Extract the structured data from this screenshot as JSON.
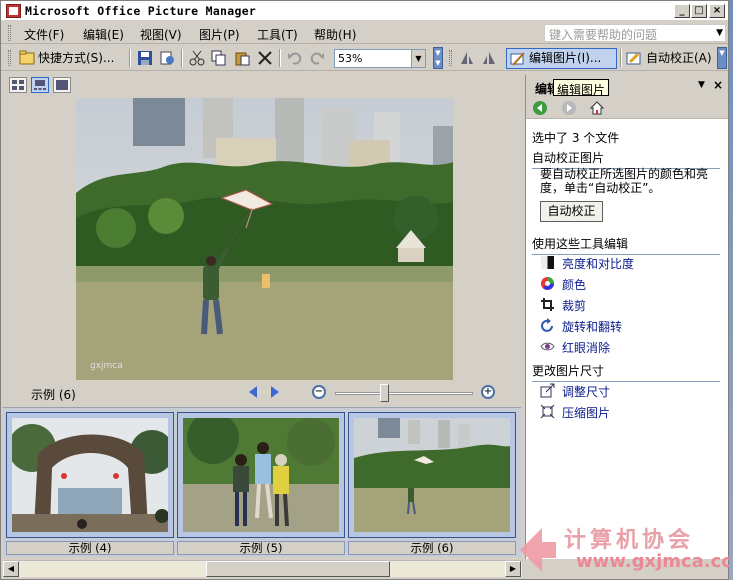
{
  "window": {
    "title": "Microsoft Office Picture Manager",
    "controls": [
      "_",
      "□",
      "×"
    ]
  },
  "menu": {
    "items": [
      "文件(F)",
      "编辑(E)",
      "视图(V)",
      "图片(P)",
      "工具(T)",
      "帮助(H)"
    ],
    "help_placeholder": "键入需要帮助的问题"
  },
  "toolbar": {
    "shortcuts_label": "快捷方式(S)...",
    "zoom_value": "53%",
    "edit_pictures_label": "编辑图片(I)...",
    "auto_correct_label": "自动校正(A)"
  },
  "main": {
    "current_label": "示例 (6)",
    "thumbnails": [
      {
        "caption": "示例 (4)",
        "selected": true
      },
      {
        "caption": "示例 (5)",
        "selected": true
      },
      {
        "caption": "示例 (6)",
        "selected": true
      }
    ]
  },
  "pane": {
    "title": "编辑",
    "tooltip": "编辑图片",
    "selected_text": "选中了 3 个文件",
    "auto_section": "自动校正图片",
    "auto_desc": "要自动校正所选图片的颜色和亮度，单击“自动校正”。",
    "auto_button": "自动校正",
    "tools_section": "使用这些工具编辑",
    "tools": [
      "亮度和对比度",
      "颜色",
      "裁剪",
      "旋转和翻转",
      "红眼消除"
    ],
    "size_section": "更改图片尺寸",
    "size_tools": [
      "调整尺寸",
      "压缩图片"
    ]
  },
  "watermark": {
    "chinese": "计算机协会",
    "url": "www.gxjmca.com"
  },
  "colors": {
    "toolbar": "#d4d0c8",
    "accent": "#316ac5",
    "link": "#0a1a8c",
    "watermark": "#e9a0a8"
  }
}
